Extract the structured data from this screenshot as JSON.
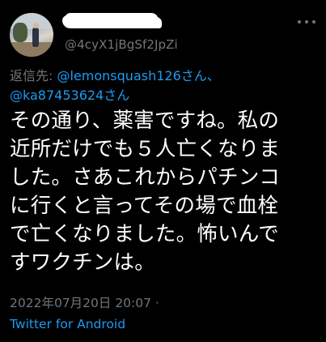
{
  "colors": {
    "background": "#000000",
    "text": "#ffffff",
    "secondary": "#71767b",
    "link": "#1d9bf0"
  },
  "user": {
    "handle": "@4cyX1jBgSf2JpZi"
  },
  "reply": {
    "prefix": "返信先:",
    "mention1": "@lemonsquash126さん、",
    "mention2": "@ka87453624さん"
  },
  "tweet": {
    "lines": [
      "その通り、薬害ですね。私の",
      "近所だけでも５人亡くなりま",
      "した。さあこれからパチンコ",
      "に行くと言ってその場で血栓",
      "で亡くなりました。怖いんで",
      "すワクチンは。"
    ]
  },
  "meta": {
    "timestamp": "2022年07月20日 20:07 ·",
    "source": "Twitter for Android"
  },
  "icons": {
    "more": "more-options-icon"
  }
}
